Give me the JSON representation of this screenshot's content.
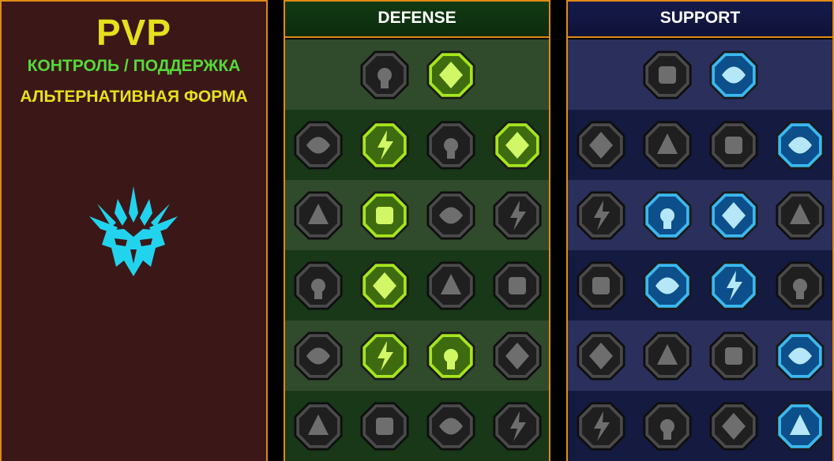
{
  "left": {
    "title": "PVP",
    "role": "КОНТРОЛЬ / ПОДДЕРЖКА",
    "form": "АЛЬТЕРНАТИВНАЯ ФОРМА",
    "emblem_icon": "mask-crest-icon",
    "emblem_color": "#22d3ee"
  },
  "colors": {
    "border": "#e08a17",
    "defense_active": "#a5e61d",
    "support_active": "#3bb8f0",
    "inactive": "#2a2a2a"
  },
  "trees": [
    {
      "id": "defense",
      "title": "DEFENSE",
      "rows": [
        [
          {
            "icon": "broken-wall-icon",
            "active": false
          },
          {
            "icon": "raised-fist-icon",
            "active": true
          }
        ],
        [
          {
            "icon": "layered-shield-icon",
            "active": false
          },
          {
            "icon": "armored-heart-icon",
            "active": true
          },
          {
            "icon": "rock-golem-icon",
            "active": false
          },
          {
            "icon": "crossed-blades-icon",
            "active": true
          }
        ],
        [
          {
            "icon": "tailed-hero-icon",
            "active": false
          },
          {
            "icon": "knight-shield-icon",
            "active": true
          },
          {
            "icon": "heart-skull-icon",
            "active": false
          },
          {
            "icon": "haloed-head-icon",
            "active": false
          }
        ],
        [
          {
            "icon": "crowd-icon",
            "active": false
          },
          {
            "icon": "hourglass-skull-icon",
            "active": true
          },
          {
            "icon": "open-hand-icon",
            "active": false
          },
          {
            "icon": "bull-head-icon",
            "active": false
          }
        ],
        [
          {
            "icon": "dashing-runner-icon",
            "active": false
          },
          {
            "icon": "claw-flames-icon",
            "active": true
          },
          {
            "icon": "radiant-skull-icon",
            "active": true
          },
          {
            "icon": "swirling-hand-icon",
            "active": false
          }
        ],
        [
          {
            "icon": "crowned-warrior-icon",
            "active": false
          },
          {
            "icon": "winged-shield-icon",
            "active": false
          },
          {
            "icon": "burst-skull-icon",
            "active": false
          },
          {
            "icon": "flexing-hero-icon",
            "active": false
          }
        ]
      ]
    },
    {
      "id": "support",
      "title": "SUPPORT",
      "rows": [
        [
          {
            "icon": "heart-plus-icon",
            "active": false
          },
          {
            "icon": "energy-gauge-icon",
            "active": true
          }
        ],
        [
          {
            "icon": "praying-hands-icon",
            "active": false
          },
          {
            "icon": "arched-shield-icon",
            "active": false
          },
          {
            "icon": "smoking-skull-icon",
            "active": false
          },
          {
            "icon": "shattered-arm-icon",
            "active": true
          }
        ],
        [
          {
            "icon": "sparkle-figure-icon",
            "active": false
          },
          {
            "icon": "lightning-bolt-icon",
            "active": true
          },
          {
            "icon": "zigzag-bolt-icon",
            "active": true
          },
          {
            "icon": "silhouettes-icon",
            "active": false
          }
        ],
        [
          {
            "icon": "chained-heart-icon",
            "active": false
          },
          {
            "icon": "comet-icon",
            "active": true
          },
          {
            "icon": "open-book-icon",
            "active": true
          },
          {
            "icon": "angry-eyes-icon",
            "active": false
          }
        ],
        [
          {
            "icon": "compass-star-icon",
            "active": false
          },
          {
            "icon": "winged-boot-icon",
            "active": false
          },
          {
            "icon": "all-seeing-eye-icon",
            "active": false
          },
          {
            "icon": "bound-figure-icon",
            "active": true
          }
        ],
        [
          {
            "icon": "potion-flask-icon",
            "active": false
          },
          {
            "icon": "winged-skull-icon",
            "active": false
          },
          {
            "icon": "gripping-fist-icon",
            "active": false
          },
          {
            "icon": "eagle-head-icon",
            "active": true
          }
        ]
      ]
    }
  ]
}
